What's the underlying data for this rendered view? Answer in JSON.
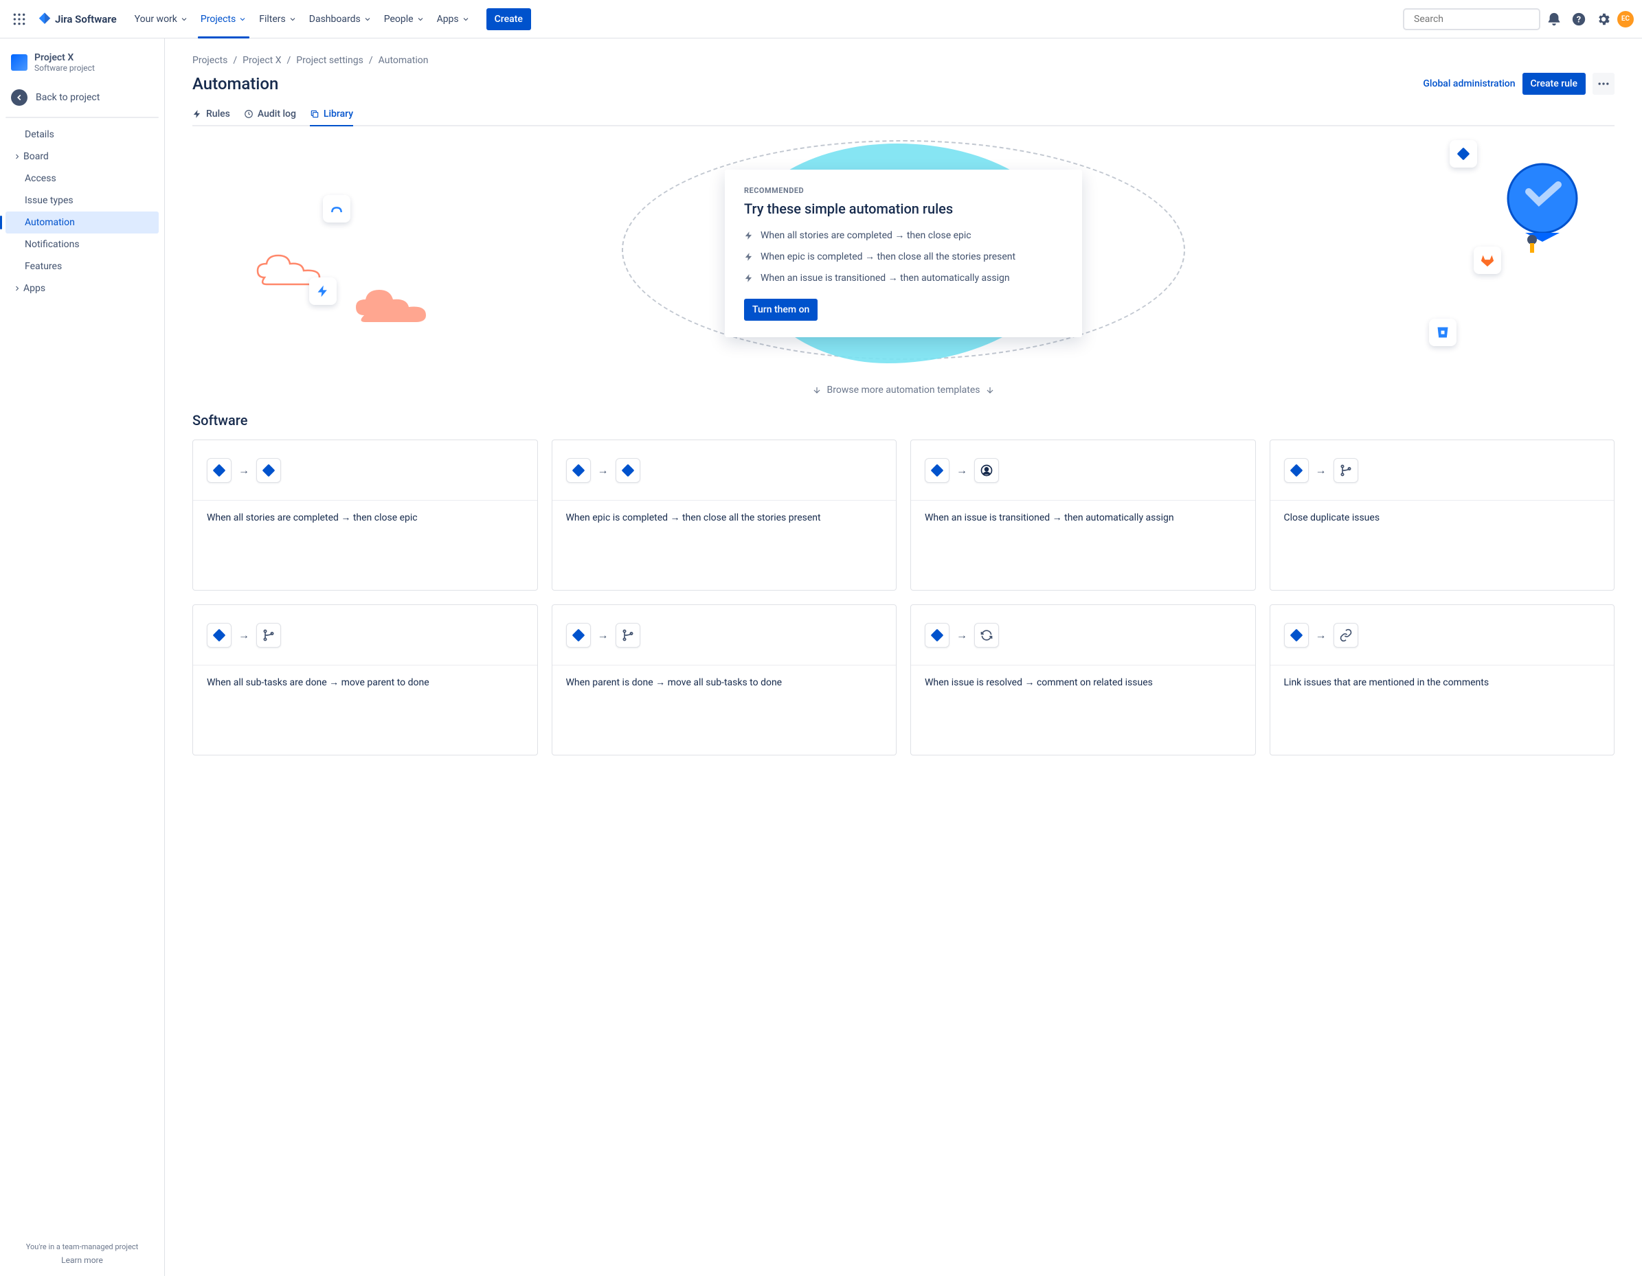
{
  "topnav": {
    "product": "Jira Software",
    "items": [
      "Your work",
      "Projects",
      "Filters",
      "Dashboards",
      "People",
      "Apps"
    ],
    "active_index": 1,
    "create": "Create",
    "search_placeholder": "Search",
    "avatar_initials": "EC"
  },
  "sidebar": {
    "project_name": "Project X",
    "project_sub": "Software project",
    "back": "Back to project",
    "items": [
      {
        "label": "Details",
        "expandable": false
      },
      {
        "label": "Board",
        "expandable": true
      },
      {
        "label": "Access",
        "expandable": false
      },
      {
        "label": "Issue types",
        "expandable": false
      },
      {
        "label": "Automation",
        "expandable": false,
        "active": true
      },
      {
        "label": "Notifications",
        "expandable": false
      },
      {
        "label": "Features",
        "expandable": false
      },
      {
        "label": "Apps",
        "expandable": true
      }
    ],
    "footer1": "You're in a team-managed project",
    "footer2": "Learn more"
  },
  "breadcrumbs": [
    "Projects",
    "Project X",
    "Project settings",
    "Automation"
  ],
  "page": {
    "title": "Automation",
    "global_admin": "Global administration",
    "create_rule": "Create rule"
  },
  "tabs": [
    {
      "label": "Rules",
      "icon": "bolt"
    },
    {
      "label": "Audit log",
      "icon": "clock"
    },
    {
      "label": "Library",
      "icon": "copy",
      "active": true
    }
  ],
  "hero": {
    "eyebrow": "RECOMMENDED",
    "title": "Try these simple automation rules",
    "rules": [
      "When all stories are completed → then close epic",
      "When epic is completed → then close all the stories present",
      "When an issue is transitioned → then automatically assign"
    ],
    "cta": "Turn them on"
  },
  "browse_more": "Browse more automation templates",
  "section_title": "Software",
  "templates": [
    {
      "text": "When all stories are completed → then close epic",
      "to": "jira"
    },
    {
      "text": "When epic is completed → then close all the stories present",
      "to": "jira"
    },
    {
      "text": "When an issue is transitioned → then automatically assign",
      "to": "user"
    },
    {
      "text": "Close duplicate issues",
      "to": "branch"
    },
    {
      "text": "When all sub-tasks are done → move parent to done",
      "to": "branch"
    },
    {
      "text": "When parent is done → move all sub-tasks to done",
      "to": "branch"
    },
    {
      "text": "When issue is resolved → comment on related issues",
      "to": "refresh"
    },
    {
      "text": "Link issues that are mentioned in the comments",
      "to": "link"
    }
  ]
}
